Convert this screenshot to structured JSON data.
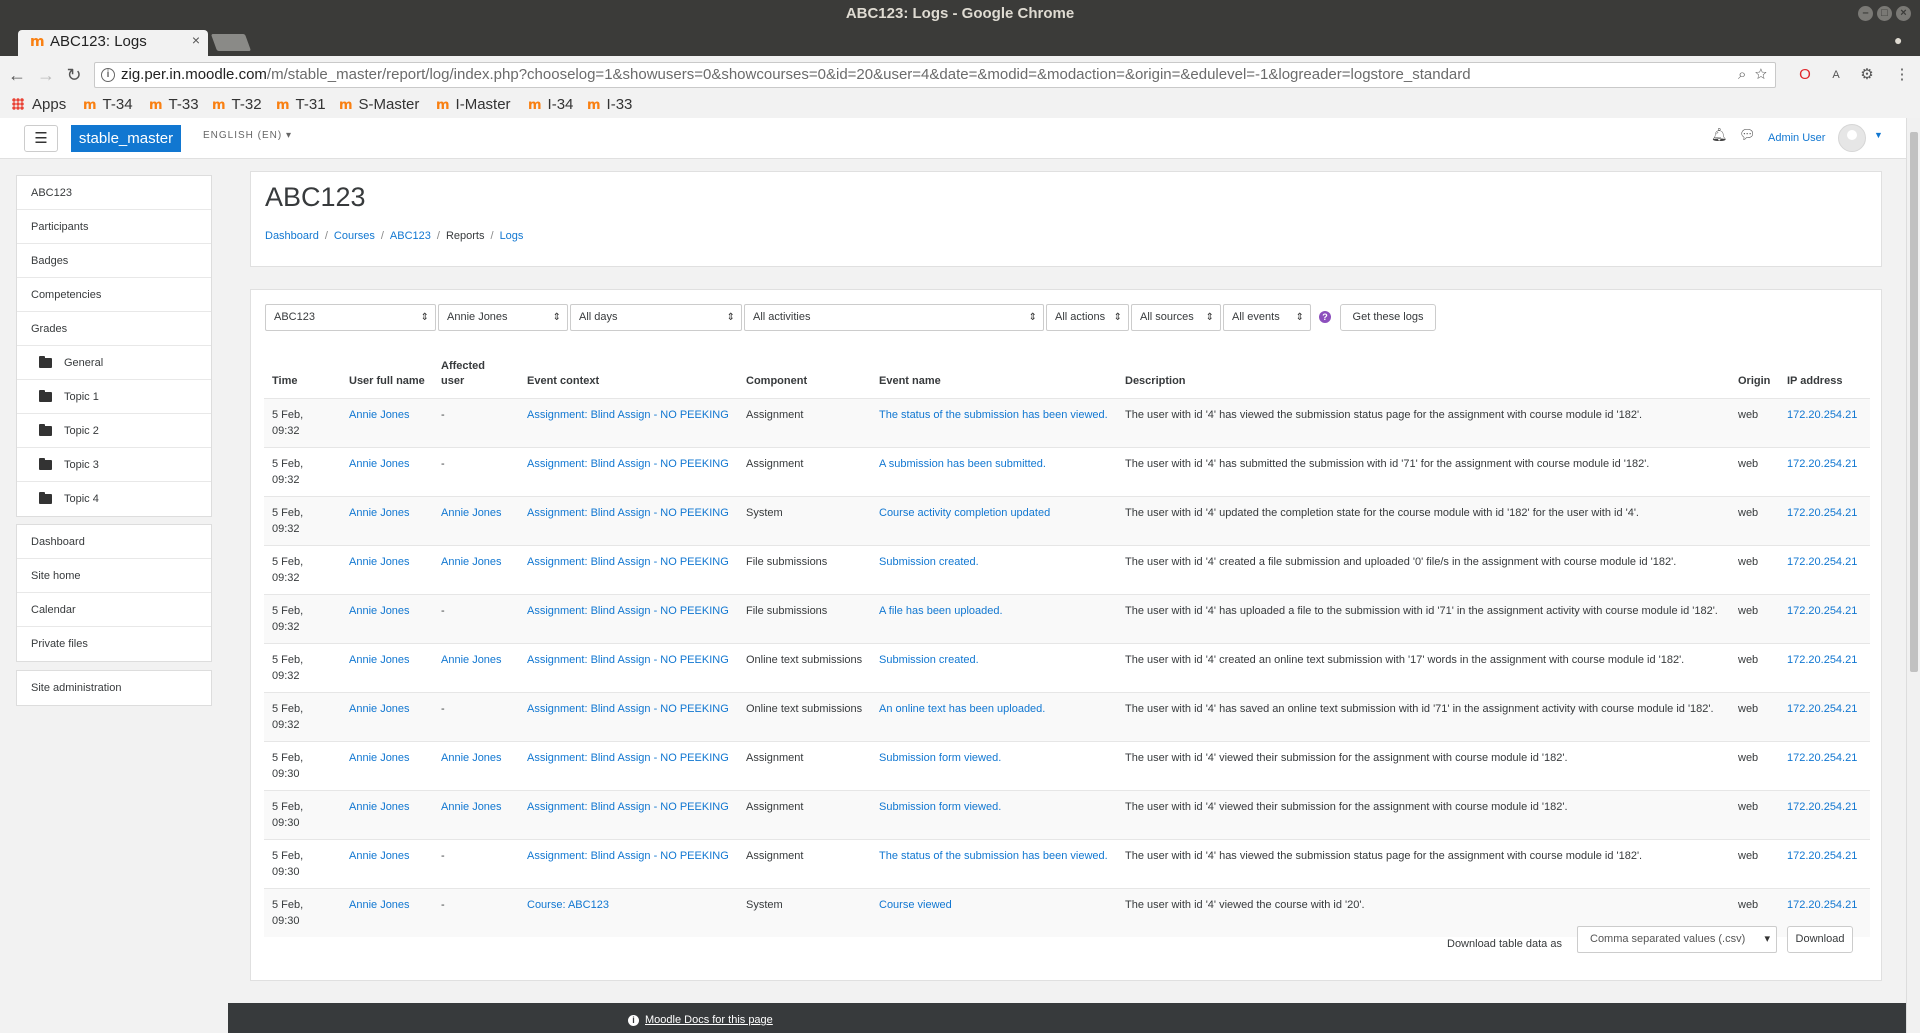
{
  "window": {
    "title": "ABC123: Logs - Google Chrome"
  },
  "tabs": [
    {
      "label": "ABC123: Logs"
    }
  ],
  "address": {
    "host": "zig.per.in.moodle.com",
    "path": "/m/stable_master/report/log/index.php?chooselog=1&showusers=0&showcourses=0&id=20&user=4&date=&modid=&modaction=&origin=&edulevel=-1&logreader=logstore_standard"
  },
  "bookmarks": [
    "Apps",
    "T-34",
    "T-33",
    "T-32",
    "T-31",
    "S-Master",
    "I-Master",
    "I-34",
    "I-33"
  ],
  "navbar": {
    "site": "stable_master",
    "language": "ENGLISH (EN)",
    "user": "Admin User"
  },
  "sidebar": {
    "course": [
      {
        "label": "ABC123",
        "folder": false
      },
      {
        "label": "Participants",
        "folder": false
      },
      {
        "label": "Badges",
        "folder": false
      },
      {
        "label": "Competencies",
        "folder": false
      },
      {
        "label": "Grades",
        "folder": false
      },
      {
        "label": "General",
        "folder": true
      },
      {
        "label": "Topic 1",
        "folder": true
      },
      {
        "label": "Topic 2",
        "folder": true
      },
      {
        "label": "Topic 3",
        "folder": true
      },
      {
        "label": "Topic 4",
        "folder": true
      }
    ],
    "site": [
      "Dashboard",
      "Site home",
      "Calendar",
      "Private files"
    ],
    "admin": [
      "Site administration"
    ]
  },
  "header": {
    "title": "ABC123",
    "breadcrumb": [
      {
        "label": "Dashboard",
        "link": true
      },
      {
        "label": "Courses",
        "link": true
      },
      {
        "label": "ABC123",
        "link": true
      },
      {
        "label": "Reports",
        "link": false
      },
      {
        "label": "Logs",
        "link": true
      }
    ]
  },
  "filters": {
    "course": "ABC123",
    "user": "Annie Jones",
    "date": "All days",
    "activity": "All activities",
    "action": "All actions",
    "origin": "All sources",
    "edulevel": "All events",
    "submit": "Get these logs"
  },
  "table": {
    "headers": [
      "Time",
      "User full name",
      "Affected user",
      "Event context",
      "Component",
      "Event name",
      "Description",
      "Origin",
      "IP address"
    ],
    "rows": [
      [
        "5 Feb, 09:32",
        "Annie Jones",
        "-",
        "Assignment: Blind Assign - NO PEEKING",
        "Assignment",
        "The status of the submission has been viewed.",
        "The user with id '4' has viewed the submission status page for the assignment with course module id '182'.",
        "web",
        "172.20.254.21"
      ],
      [
        "5 Feb, 09:32",
        "Annie Jones",
        "-",
        "Assignment: Blind Assign - NO PEEKING",
        "Assignment",
        "A submission has been submitted.",
        "The user with id '4' has submitted the submission with id '71' for the assignment with course module id '182'.",
        "web",
        "172.20.254.21"
      ],
      [
        "5 Feb, 09:32",
        "Annie Jones",
        "Annie Jones",
        "Assignment: Blind Assign - NO PEEKING",
        "System",
        "Course activity completion updated",
        "The user with id '4' updated the completion state for the course module with id '182' for the user with id '4'.",
        "web",
        "172.20.254.21"
      ],
      [
        "5 Feb, 09:32",
        "Annie Jones",
        "Annie Jones",
        "Assignment: Blind Assign - NO PEEKING",
        "File submissions",
        "Submission created.",
        "The user with id '4' created a file submission and uploaded '0' file/s in the assignment with course module id '182'.",
        "web",
        "172.20.254.21"
      ],
      [
        "5 Feb, 09:32",
        "Annie Jones",
        "-",
        "Assignment: Blind Assign - NO PEEKING",
        "File submissions",
        "A file has been uploaded.",
        "The user with id '4' has uploaded a file to the submission with id '71' in the assignment activity with course module id '182'.",
        "web",
        "172.20.254.21"
      ],
      [
        "5 Feb, 09:32",
        "Annie Jones",
        "Annie Jones",
        "Assignment: Blind Assign - NO PEEKING",
        "Online text submissions",
        "Submission created.",
        "The user with id '4' created an online text submission with '17' words in the assignment with course module id '182'.",
        "web",
        "172.20.254.21"
      ],
      [
        "5 Feb, 09:32",
        "Annie Jones",
        "-",
        "Assignment: Blind Assign - NO PEEKING",
        "Online text submissions",
        "An online text has been uploaded.",
        "The user with id '4' has saved an online text submission with id '71' in the assignment activity with course module id '182'.",
        "web",
        "172.20.254.21"
      ],
      [
        "5 Feb, 09:30",
        "Annie Jones",
        "Annie Jones",
        "Assignment: Blind Assign - NO PEEKING",
        "Assignment",
        "Submission form viewed.",
        "The user with id '4' viewed their submission for the assignment with course module id '182'.",
        "web",
        "172.20.254.21"
      ],
      [
        "5 Feb, 09:30",
        "Annie Jones",
        "Annie Jones",
        "Assignment: Blind Assign - NO PEEKING",
        "Assignment",
        "Submission form viewed.",
        "The user with id '4' viewed their submission for the assignment with course module id '182'.",
        "web",
        "172.20.254.21"
      ],
      [
        "5 Feb, 09:30",
        "Annie Jones",
        "-",
        "Assignment: Blind Assign - NO PEEKING",
        "Assignment",
        "The status of the submission has been viewed.",
        "The user with id '4' has viewed the submission status page for the assignment with course module id '182'.",
        "web",
        "172.20.254.21"
      ],
      [
        "5 Feb, 09:30",
        "Annie Jones",
        "-",
        "Course: ABC123",
        "System",
        "Course viewed",
        "The user with id '4' viewed the course with id '20'.",
        "web",
        "172.20.254.21"
      ]
    ]
  },
  "download": {
    "label": "Download table data as",
    "format": "Comma separated values (.csv)",
    "button": "Download"
  },
  "footer": {
    "docs_link": "Moodle Docs for this page"
  }
}
